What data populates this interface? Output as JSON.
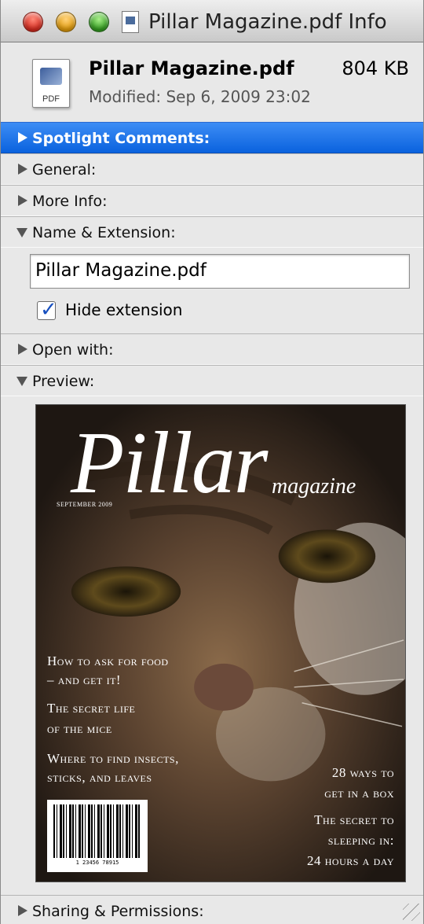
{
  "window": {
    "title": "Pillar Magazine.pdf Info"
  },
  "file": {
    "name": "Pillar Magazine.pdf",
    "size": "804 KB",
    "modified": "Modified: Sep 6, 2009 23:02",
    "icon_label": "PDF"
  },
  "sections": {
    "spotlight": "Spotlight Comments:",
    "general": "General:",
    "more_info": "More Info:",
    "name_extension": "Name & Extension:",
    "open_with": "Open with:",
    "preview": "Preview:",
    "sharing": "Sharing & Permissions:"
  },
  "name_extension": {
    "value": "Pillar Magazine.pdf",
    "hide_extension_label": "Hide extension",
    "hide_extension_checked": true
  },
  "cover": {
    "title": "Pillar",
    "subtitle": "magazine",
    "date": "SEPTEMBER 2009",
    "lines_left": [
      "How to ask for food",
      "– and get it!",
      "The secret life",
      "of the mice",
      "Where to find insects,",
      "sticks, and leaves"
    ],
    "lines_right": [
      "28 ways to",
      "get in a box",
      "The secret to",
      "sleeping in:",
      "24 hours a day"
    ],
    "barcode_digits": "1 23456 78915"
  },
  "colors": {
    "selection_blue": "#1a6fe8",
    "window_bg": "#e8e8e8"
  }
}
